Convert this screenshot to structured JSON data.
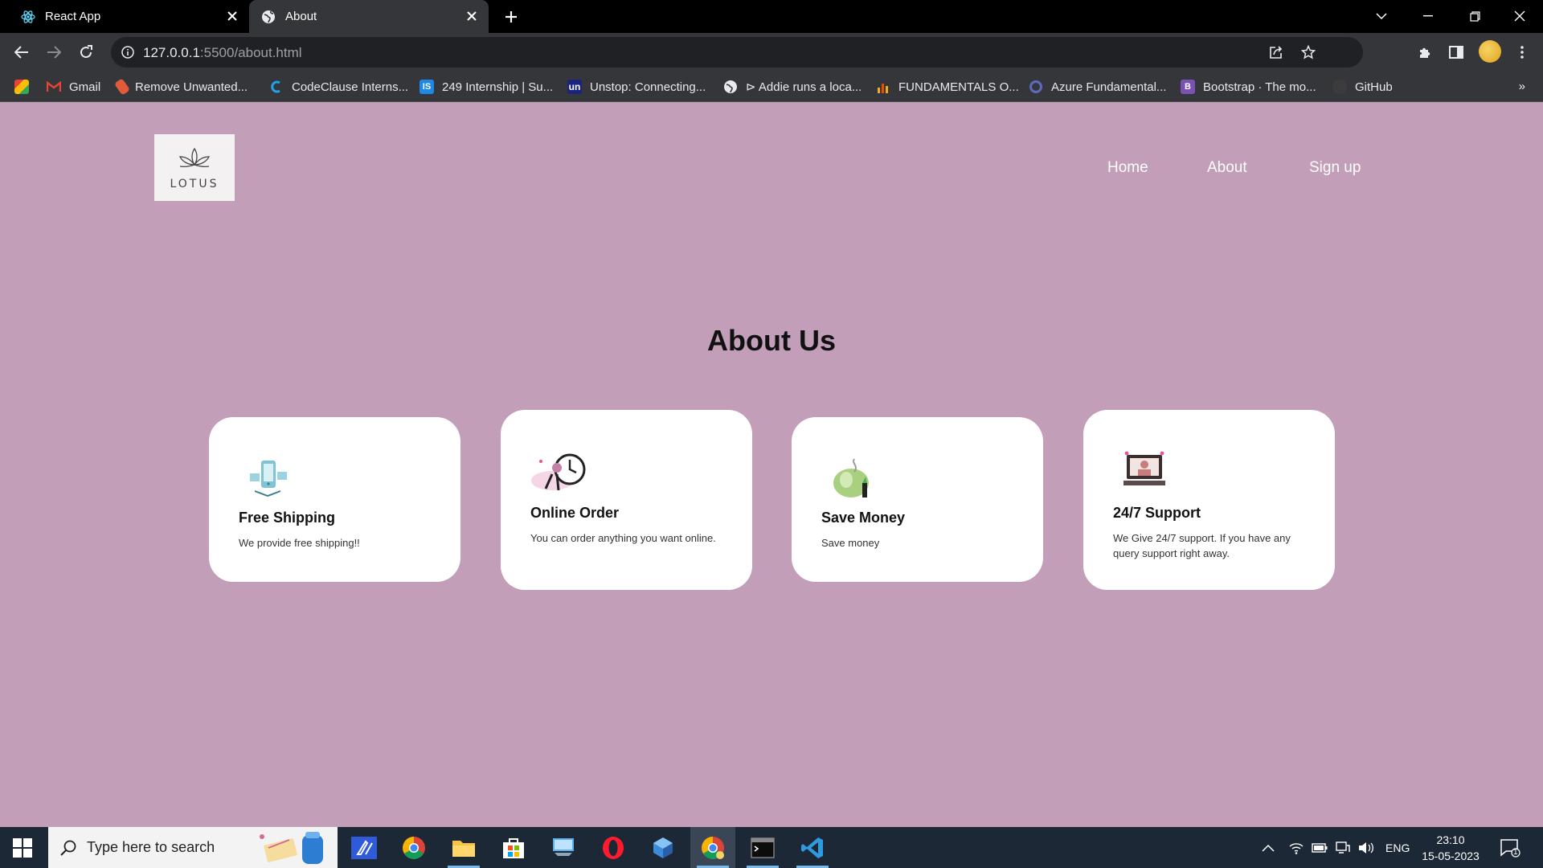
{
  "browser": {
    "tabs": [
      {
        "title": "React App",
        "icon": "react-icon"
      },
      {
        "title": "About",
        "icon": "globe-icon"
      }
    ],
    "url_host": "127.0.0.1",
    "url_path": ":5500/about.html"
  },
  "bookmarks": [
    {
      "label": "",
      "icon": "apps-icon",
      "color": "#f4b400"
    },
    {
      "label": "Gmail",
      "icon": "gmail-icon",
      "color": "#ea4335"
    },
    {
      "label": "Remove Unwanted...",
      "icon": "eraser-icon",
      "color": "#e15a3a"
    },
    {
      "label": "CodeClause Interns...",
      "icon": "codeclause-icon",
      "color": "#1fa2e8"
    },
    {
      "label": "249 Internship | Su...",
      "icon": "is-icon",
      "color": "#1e88e5"
    },
    {
      "label": "Unstop: Connecting...",
      "icon": "un-icon",
      "color": "#1a237e"
    },
    {
      "label": "⊳ Addie runs a loca...",
      "icon": "globe-icon",
      "color": "#e8eaed"
    },
    {
      "label": "FUNDAMENTALS O...",
      "icon": "chart-icon",
      "color": "#f9a825"
    },
    {
      "label": "Azure Fundamental...",
      "icon": "azure-icon",
      "color": "#5c6bc0"
    },
    {
      "label": "Bootstrap · The mo...",
      "icon": "bootstrap-icon",
      "color": "#7952b3"
    },
    {
      "label": "GitHub",
      "icon": "github-icon",
      "color": "#555"
    }
  ],
  "site": {
    "logo_text": "LOTUS",
    "nav": [
      "Home",
      "About",
      "Sign up"
    ],
    "heading": "About Us",
    "cards": [
      {
        "title": "Free Shipping",
        "text": "We provide free shipping!!",
        "icon": "shipping-icon"
      },
      {
        "title": "Online Order",
        "text": "You can order anything you want online.",
        "icon": "online-order-icon"
      },
      {
        "title": "Save Money",
        "text": "Save money",
        "icon": "piggy-bank-icon"
      },
      {
        "title": "24/7 Support",
        "text": "We Give 24/7 support. If you have any query support right away.",
        "icon": "support-icon"
      }
    ]
  },
  "taskbar": {
    "search_placeholder": "Type here to search",
    "language": "ENG",
    "time": "23:10",
    "date": "15-05-2023",
    "notification_count": "1"
  }
}
